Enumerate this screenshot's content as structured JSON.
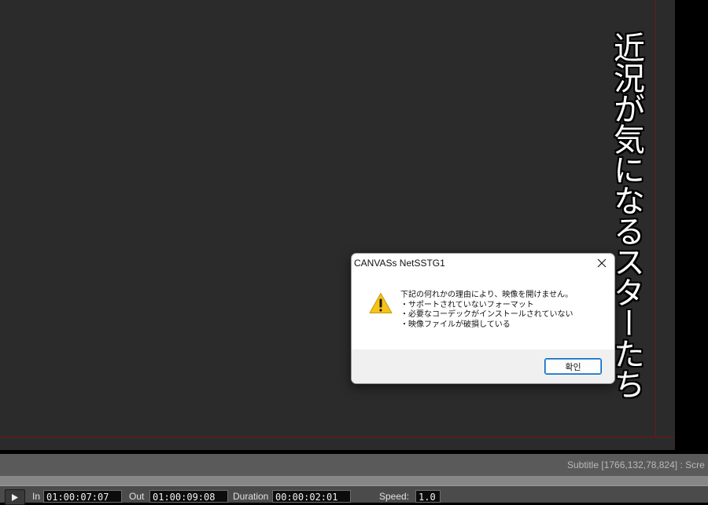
{
  "subtitle_overlay": {
    "text": "近況が気になるスターたち"
  },
  "dialog": {
    "title": "CANVASs NetSSTG1",
    "close_icon": "close-icon",
    "icon": "warning-icon",
    "message_lines": [
      "下記の何れかの理由により、映像を開けません。",
      "・サポートされていないフォーマット",
      "・必要なコーデックがインストールされていない",
      "・映像ファイルが破損している"
    ],
    "ok_label": "확인"
  },
  "status_bar": {
    "text": "Subtitle [1766,132,78,824] : Scre"
  },
  "controls": {
    "play_icon": "play-icon",
    "in_label": "In",
    "in_value": "01:00:07:07",
    "out_label": "Out",
    "out_value": "01:00:09:08",
    "duration_label": "Duration",
    "duration_value": "00:00:02:01",
    "speed_label": "Speed:",
    "speed_value": "1.0"
  },
  "colors": {
    "canvas_bg": "#2b2b2b",
    "guide_line": "#7a1414",
    "accent_button_border": "#0067c0",
    "warning_yellow": "#f7c21a"
  }
}
